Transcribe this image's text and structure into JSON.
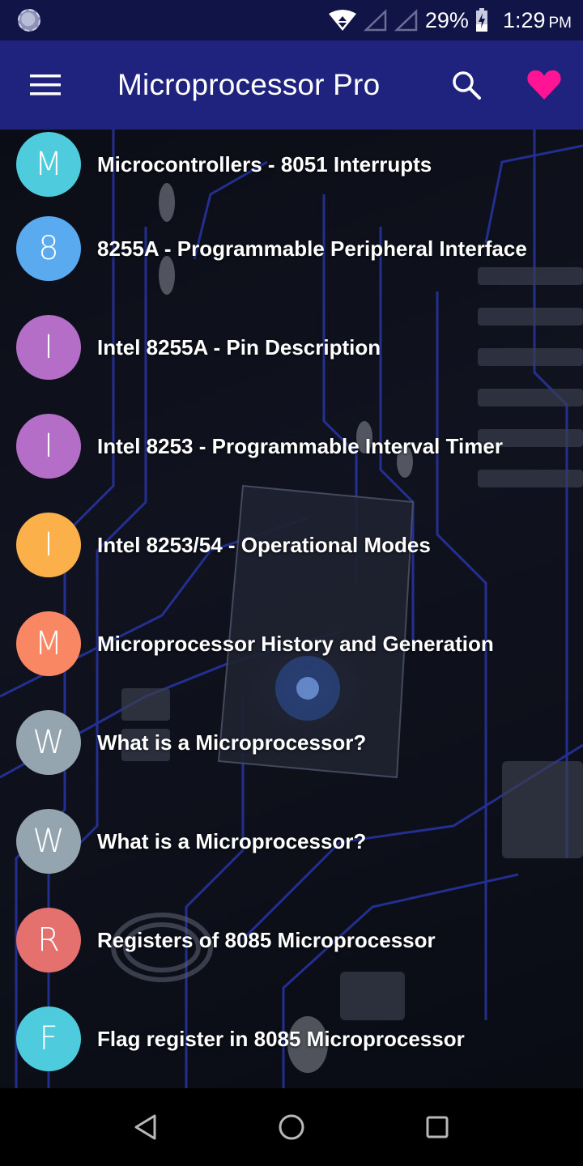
{
  "status_bar": {
    "battery": "29%",
    "time": "1:29",
    "ampm": "PM"
  },
  "app_bar": {
    "title": "Microprocessor Pro"
  },
  "icons": {
    "menu": "menu-icon",
    "search": "search-icon",
    "favorite": "heart-icon",
    "back": "back-icon",
    "home": "home-icon",
    "recents": "recents-icon"
  },
  "colors": {
    "status_bar": "#111447",
    "app_bar": "#1f237e",
    "favorite": "#ff1493"
  },
  "topics": [
    {
      "initial": "M",
      "title": "Microcontrollers - 8051 Interrupts",
      "color": "#4ecbdc"
    },
    {
      "initial": "8",
      "title": "8255A - Programmable Peripheral Interface",
      "color": "#5aaaf0"
    },
    {
      "initial": "I",
      "title": "Intel 8255A - Pin Description",
      "color": "#b46ec8"
    },
    {
      "initial": "I",
      "title": "Intel 8253 - Programmable Interval Timer",
      "color": "#b46ec8"
    },
    {
      "initial": "I",
      "title": "Intel 8253/54 - Operational Modes",
      "color": "#fbb04a"
    },
    {
      "initial": "M",
      "title": "Microprocessor History and Generation",
      "color": "#fa8764"
    },
    {
      "initial": "W",
      "title": "What is a Microprocessor?",
      "color": "#95a5b0"
    },
    {
      "initial": "W",
      "title": "What is a Microprocessor?",
      "color": "#95a5b0"
    },
    {
      "initial": "R",
      "title": "Registers of 8085 Microprocessor",
      "color": "#e5716f"
    },
    {
      "initial": "F",
      "title": "Flag register in 8085 Microprocessor",
      "color": "#4ecbdc"
    }
  ]
}
